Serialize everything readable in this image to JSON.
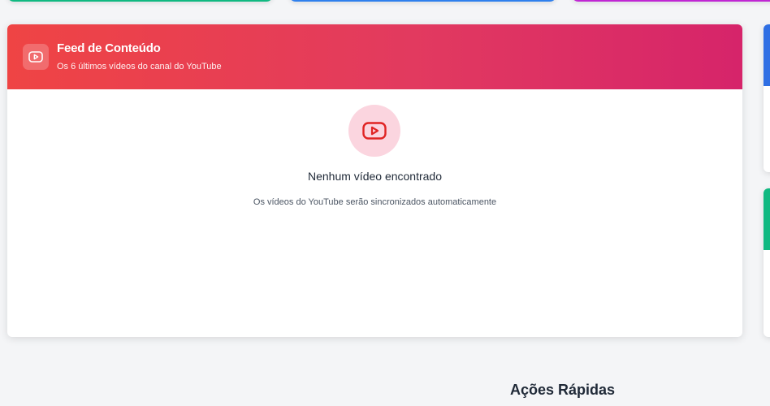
{
  "colors": {
    "top_card_1_accent": "#10b981",
    "top_card_2_accent": "#2f80ed",
    "top_card_3_accent": "#c026d3",
    "feed_header_start": "#ef4444",
    "feed_header_end": "#d6246a",
    "youtube_icon": "#e02424",
    "empty_icon_bg": "#fbd5df",
    "side_card_1_accent": "#2f6fe4",
    "side_card_2_accent": "#10b981"
  },
  "feed": {
    "title": "Feed de Conteúdo",
    "subtitle": "Os 6 últimos vídeos do canal do YouTube",
    "header_icon": "youtube-icon",
    "empty_icon": "youtube-icon",
    "empty_title": "Nenhum vídeo encontrado",
    "empty_subtitle": "Os vídeos do YouTube serão sincronizados automaticamente"
  },
  "quick_actions": {
    "title": "Ações Rápidas"
  }
}
